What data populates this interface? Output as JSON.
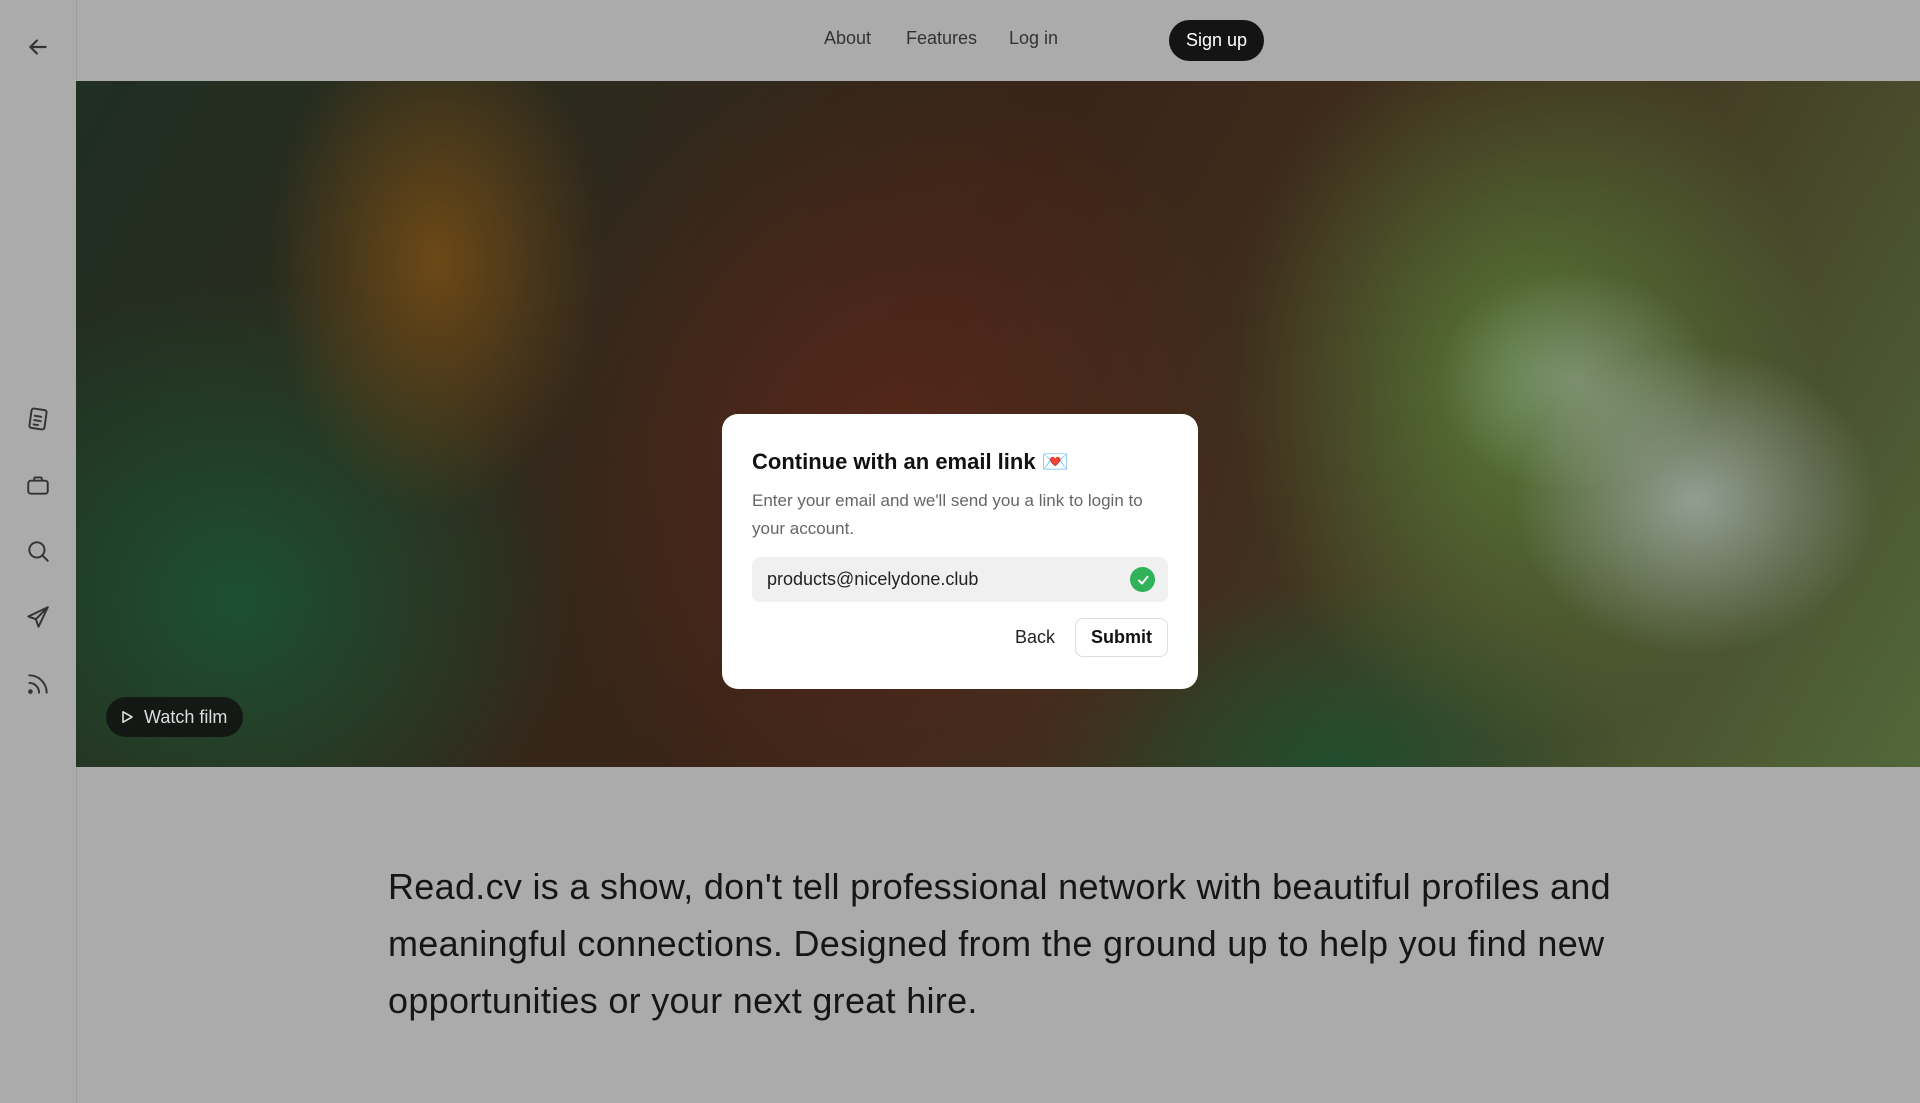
{
  "nav": {
    "about": "About",
    "features": "Features",
    "login": "Log in",
    "signup": "Sign up"
  },
  "sidebar": {
    "back_icon": "arrow-left-icon",
    "items": [
      {
        "icon": "document-icon"
      },
      {
        "icon": "briefcase-icon"
      },
      {
        "icon": "search-icon"
      },
      {
        "icon": "send-icon"
      },
      {
        "icon": "rss-icon"
      }
    ]
  },
  "hero": {
    "watch_film": "Watch film",
    "watch_icon": "play-icon"
  },
  "modal": {
    "title": "Continue with an email link 💌",
    "description": "Enter your email and we'll send you a link to login to your account.",
    "email_value": "products@nicelydone.club",
    "valid_icon": "check-circle-icon",
    "back": "Back",
    "submit": "Submit"
  },
  "tagline": "Read.cv is a show, don't tell professional network with beautiful profiles and meaningful connections. Designed from the ground up to help you find new opportunities or your next great hire.",
  "colors": {
    "background": "#ababab",
    "signup_bg": "#141414",
    "check_green": "#2fb25a"
  }
}
